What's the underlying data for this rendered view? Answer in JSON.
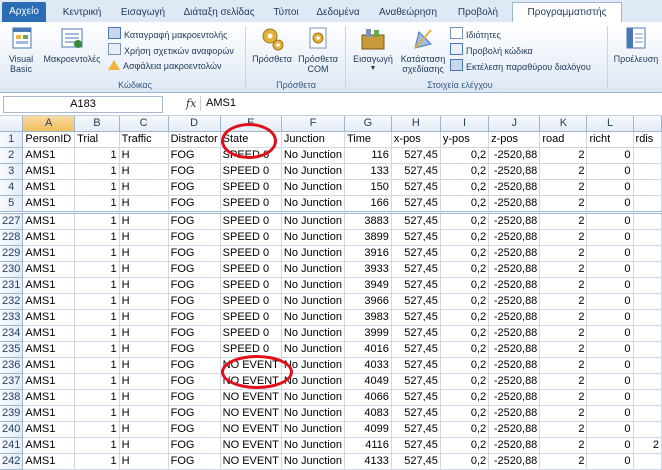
{
  "tabs": [
    "Αρχείο",
    "Κεντρική",
    "Εισαγωγή",
    "Διάταξη σελίδας",
    "Τύποι",
    "Δεδομένα",
    "Αναθεώρηση",
    "Προβολή",
    "Προγραμματιστής"
  ],
  "ribbon": {
    "visual_basic": "Visual Basic",
    "macros": "Μακροεντολές",
    "record_macro": "Καταγραφή μακροεντολής",
    "relative_refs": "Χρήση σχετικών αναφορών",
    "macro_security": "Ασφάλεια μακροεντολών",
    "group_code": "Κώδικας",
    "addins": "Πρόσθετα",
    "com_addins_1": "Πρόσθετα",
    "com_addins_2": "COM",
    "group_addins": "Πρόσθετα",
    "insert": "Εισαγωγή",
    "design_mode_1": "Κατάσταση",
    "design_mode_2": "σχεδίασης",
    "properties": "Ιδιότητες",
    "view_code": "Προβολή κώδικα",
    "run_dialog": "Εκτέλεση παραθύρου διαλόγου",
    "group_controls": "Στοιχεία ελέγχου",
    "source": "Προέλευση"
  },
  "formula_bar": {
    "name_box": "A183",
    "fx": "fx",
    "value": "AMS1"
  },
  "columns": [
    "A",
    "B",
    "C",
    "D",
    "E",
    "F",
    "G",
    "H",
    "I",
    "J",
    "K",
    "L",
    ""
  ],
  "header_row": [
    "PersonID",
    "Trial",
    "Traffic",
    "Distractor",
    "State",
    "Junction",
    "Time",
    "x-pos",
    "y-pos",
    "z-pos",
    "road",
    "richt",
    "rdis"
  ],
  "rows": [
    {
      "n": "1",
      "c": [
        "PersonID",
        "Trial",
        "Traffic",
        "Distractor",
        "State",
        "Junction",
        "Time",
        "x-pos",
        "y-pos",
        "z-pos",
        "road",
        "richt",
        "rdis"
      ]
    },
    {
      "n": "2",
      "c": [
        "AMS1",
        "1",
        "H",
        "FOG",
        "SPEED 0",
        "No Junction",
        "116",
        "527,45",
        "0,2",
        "-2520,88",
        "2",
        "0",
        ""
      ]
    },
    {
      "n": "3",
      "c": [
        "AMS1",
        "1",
        "H",
        "FOG",
        "SPEED 0",
        "No Junction",
        "133",
        "527,45",
        "0,2",
        "-2520,88",
        "2",
        "0",
        ""
      ]
    },
    {
      "n": "4",
      "c": [
        "AMS1",
        "1",
        "H",
        "FOG",
        "SPEED 0",
        "No Junction",
        "150",
        "527,45",
        "0,2",
        "-2520,88",
        "2",
        "0",
        ""
      ]
    },
    {
      "n": "5",
      "c": [
        "AMS1",
        "1",
        "H",
        "FOG",
        "SPEED 0",
        "No Junction",
        "166",
        "527,45",
        "0,2",
        "-2520,88",
        "2",
        "0",
        ""
      ]
    },
    {
      "n": "227",
      "c": [
        "AMS1",
        "1",
        "H",
        "FOG",
        "SPEED 0",
        "No Junction",
        "3883",
        "527,45",
        "0,2",
        "-2520,88",
        "2",
        "0",
        ""
      ]
    },
    {
      "n": "228",
      "c": [
        "AMS1",
        "1",
        "H",
        "FOG",
        "SPEED 0",
        "No Junction",
        "3899",
        "527,45",
        "0,2",
        "-2520,88",
        "2",
        "0",
        ""
      ]
    },
    {
      "n": "229",
      "c": [
        "AMS1",
        "1",
        "H",
        "FOG",
        "SPEED 0",
        "No Junction",
        "3916",
        "527,45",
        "0,2",
        "-2520,88",
        "2",
        "0",
        ""
      ]
    },
    {
      "n": "230",
      "c": [
        "AMS1",
        "1",
        "H",
        "FOG",
        "SPEED 0",
        "No Junction",
        "3933",
        "527,45",
        "0,2",
        "-2520,88",
        "2",
        "0",
        ""
      ]
    },
    {
      "n": "231",
      "c": [
        "AMS1",
        "1",
        "H",
        "FOG",
        "SPEED 0",
        "No Junction",
        "3949",
        "527,45",
        "0,2",
        "-2520,88",
        "2",
        "0",
        ""
      ]
    },
    {
      "n": "232",
      "c": [
        "AMS1",
        "1",
        "H",
        "FOG",
        "SPEED 0",
        "No Junction",
        "3966",
        "527,45",
        "0,2",
        "-2520,88",
        "2",
        "0",
        ""
      ]
    },
    {
      "n": "233",
      "c": [
        "AMS1",
        "1",
        "H",
        "FOG",
        "SPEED 0",
        "No Junction",
        "3983",
        "527,45",
        "0,2",
        "-2520,88",
        "2",
        "0",
        ""
      ]
    },
    {
      "n": "234",
      "c": [
        "AMS1",
        "1",
        "H",
        "FOG",
        "SPEED 0",
        "No Junction",
        "3999",
        "527,45",
        "0,2",
        "-2520,88",
        "2",
        "0",
        ""
      ]
    },
    {
      "n": "235",
      "c": [
        "AMS1",
        "1",
        "H",
        "FOG",
        "SPEED 0",
        "No Junction",
        "4016",
        "527,45",
        "0,2",
        "-2520,88",
        "2",
        "0",
        ""
      ]
    },
    {
      "n": "236",
      "c": [
        "AMS1",
        "1",
        "H",
        "FOG",
        "NO EVENT",
        "No Junction",
        "4033",
        "527,45",
        "0,2",
        "-2520,88",
        "2",
        "0",
        ""
      ]
    },
    {
      "n": "237",
      "c": [
        "AMS1",
        "1",
        "H",
        "FOG",
        "NO EVENT",
        "No Junction",
        "4049",
        "527,45",
        "0,2",
        "-2520,88",
        "2",
        "0",
        ""
      ]
    },
    {
      "n": "238",
      "c": [
        "AMS1",
        "1",
        "H",
        "FOG",
        "NO EVENT",
        "No Junction",
        "4066",
        "527,45",
        "0,2",
        "-2520,88",
        "2",
        "0",
        ""
      ]
    },
    {
      "n": "239",
      "c": [
        "AMS1",
        "1",
        "H",
        "FOG",
        "NO EVENT",
        "No Junction",
        "4083",
        "527,45",
        "0,2",
        "-2520,88",
        "2",
        "0",
        ""
      ]
    },
    {
      "n": "240",
      "c": [
        "AMS1",
        "1",
        "H",
        "FOG",
        "NO EVENT",
        "No Junction",
        "4099",
        "527,45",
        "0,2",
        "-2520,88",
        "2",
        "0",
        ""
      ]
    },
    {
      "n": "241",
      "c": [
        "AMS1",
        "1",
        "H",
        "FOG",
        "NO EVENT",
        "No Junction",
        "4116",
        "527,45",
        "0,2",
        "-2520,88",
        "2",
        "0",
        "2"
      ]
    },
    {
      "n": "242",
      "c": [
        "AMS1",
        "1",
        "H",
        "FOG",
        "NO EVENT",
        "No Junction",
        "4133",
        "527,45",
        "0,2",
        "-2520,88",
        "2",
        "0",
        ""
      ]
    }
  ],
  "colors": {
    "file_tab": "#2a6db5",
    "annotation": "#e0101a",
    "selected_header": "#f1c15f"
  }
}
